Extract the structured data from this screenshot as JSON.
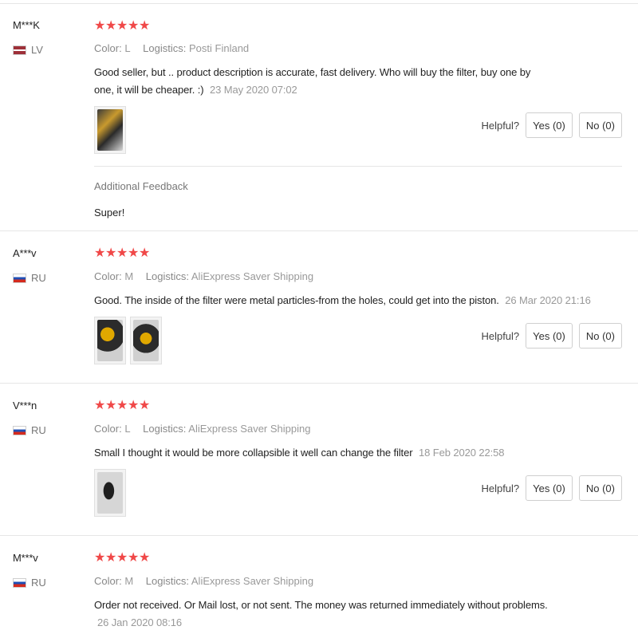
{
  "labels": {
    "color": "Color:",
    "logistics": "Logistics:",
    "helpful": "Helpful?",
    "star": "★",
    "additional_feedback": "Additional Feedback"
  },
  "reviews": [
    {
      "user": "M***K",
      "country": "LV",
      "flag": "latvia-flag",
      "rating": 5,
      "color": "L",
      "logistics": "Posti Finland",
      "text": "Good seller, but .. product description is accurate, fast delivery. Who will buy the filter, buy one by one, it will be cheaper. :)",
      "date": "23 May 2020 07:02",
      "yes": "Yes (0)",
      "no": "No (0)",
      "additional_feedback": "Super!"
    },
    {
      "user": "A***v",
      "country": "RU",
      "flag": "russia-flag",
      "rating": 5,
      "color": "M",
      "logistics": "AliExpress Saver Shipping",
      "text": "Good. The inside of the filter were metal particles-from the holes, could get into the piston.",
      "date": "26 Mar 2020 21:16",
      "yes": "Yes (0)",
      "no": "No (0)"
    },
    {
      "user": "V***n",
      "country": "RU",
      "flag": "russia-flag",
      "rating": 5,
      "color": "L",
      "logistics": "AliExpress Saver Shipping",
      "text": "Small I thought it would be more collapsible it well can change the filter",
      "date": "18 Feb 2020 22:58",
      "yes": "Yes (0)",
      "no": "No (0)"
    },
    {
      "user": "M***v",
      "country": "RU",
      "flag": "russia-flag",
      "rating": 5,
      "color": "M",
      "logistics": "AliExpress Saver Shipping",
      "text": "Order not received. Or Mail lost, or not sent. The money was returned immediately without problems.",
      "date": "26 Jan 2020 08:16"
    }
  ],
  "colors": {
    "star": "#f04848",
    "divider": "#e6e6e6",
    "muted_text": "#999999"
  }
}
